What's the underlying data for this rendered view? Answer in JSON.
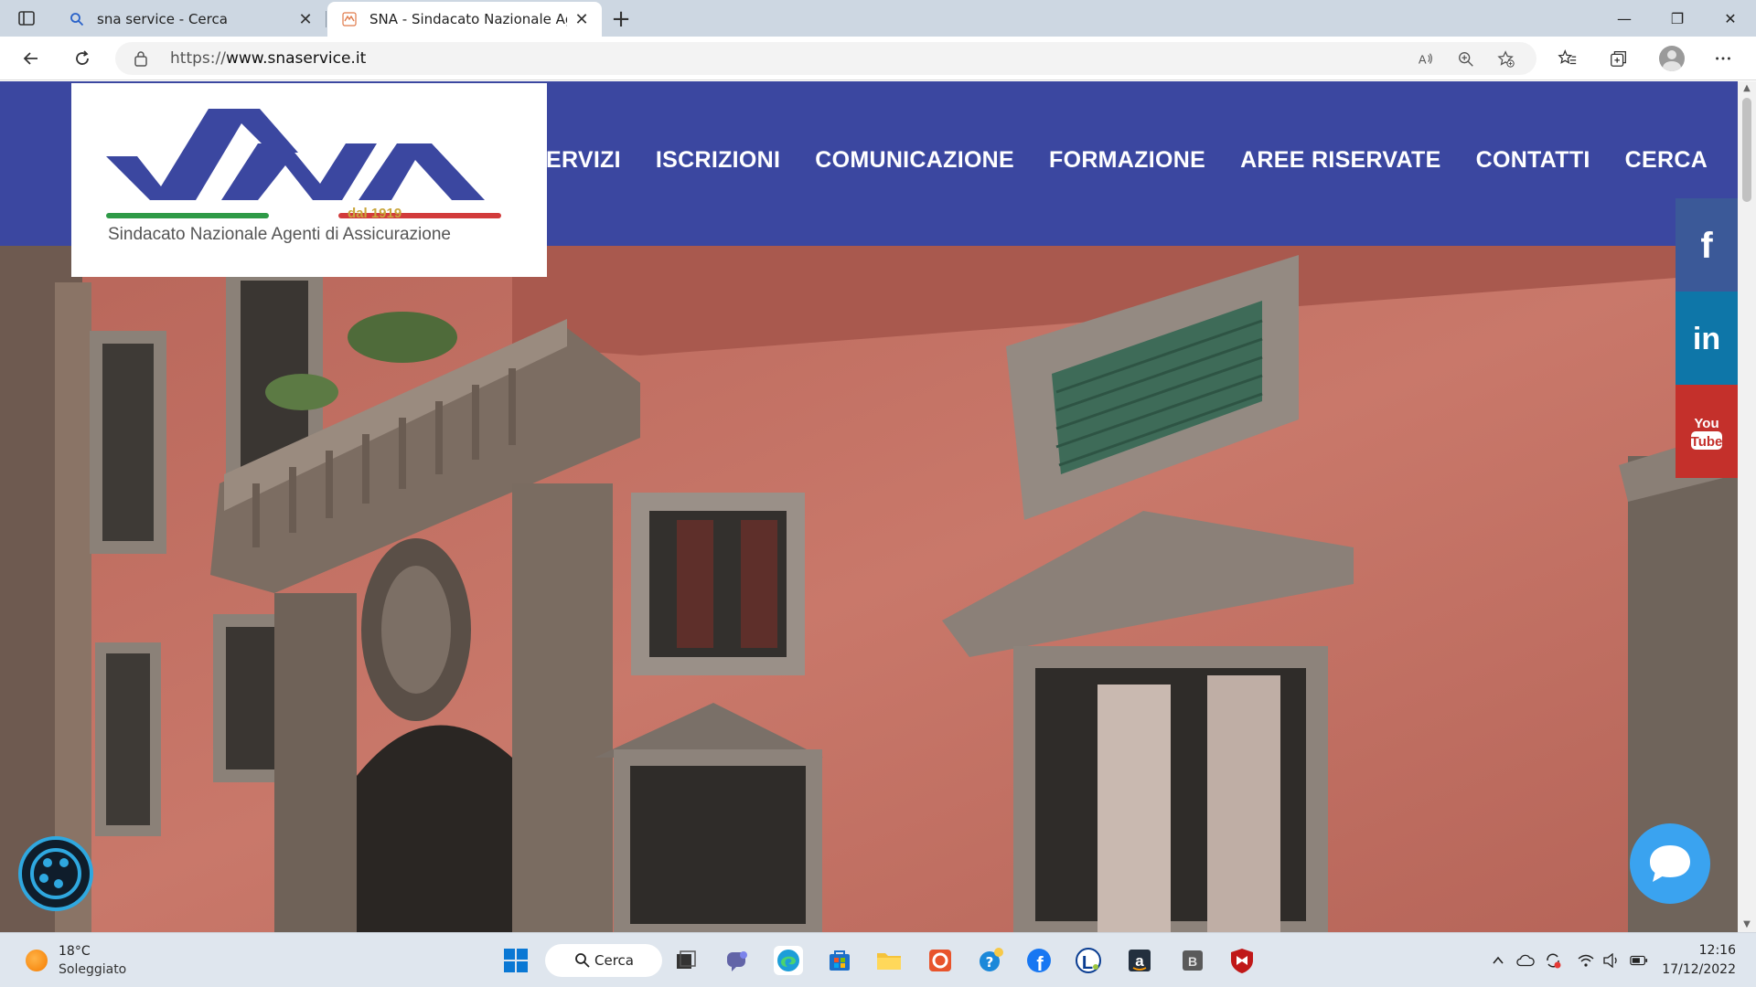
{
  "browser": {
    "tabs": [
      {
        "title": "sna service - Cerca",
        "active": false,
        "favicon": "search-icon"
      },
      {
        "title": "SNA - Sindacato Nazionale Agenti di Assicurazione",
        "active": true,
        "favicon": "sna-favicon"
      }
    ],
    "close_glyph": "✕",
    "newtab_glyph": "+",
    "window_controls": {
      "minimize": "—",
      "maximize": "❐",
      "close": "✕"
    },
    "url_prefix": "https://",
    "url_host": "www.snaservice.it"
  },
  "site": {
    "logo": {
      "since": "dal 1919",
      "tagline": "Sindacato Nazionale Agenti di Assicurazione",
      "colors": {
        "blue": "#3b47a0",
        "green": "#2e9a47",
        "red": "#d23b3b",
        "gold": "#c9a63b"
      }
    },
    "nav": [
      "SERVIZI",
      "ISCRIZIONI",
      "COMUNICAZIONE",
      "FORMAZIONE",
      "AREE RISERVATE",
      "CONTATTI",
      "CERCA"
    ],
    "social": {
      "facebook": "f",
      "linkedin": "in",
      "youtube_top": "You",
      "youtube_bottom": "Tube"
    },
    "colors": {
      "header": "#3b47a0",
      "facebook": "#3b5998",
      "linkedin": "#0e76a8",
      "youtube": "#c4302b",
      "chat": "#3aa3f0"
    }
  },
  "taskbar": {
    "weather_temp": "18°C",
    "weather_desc": "Soleggiato",
    "search_label": "Cerca",
    "time": "12:16",
    "date": "17/12/2022"
  }
}
